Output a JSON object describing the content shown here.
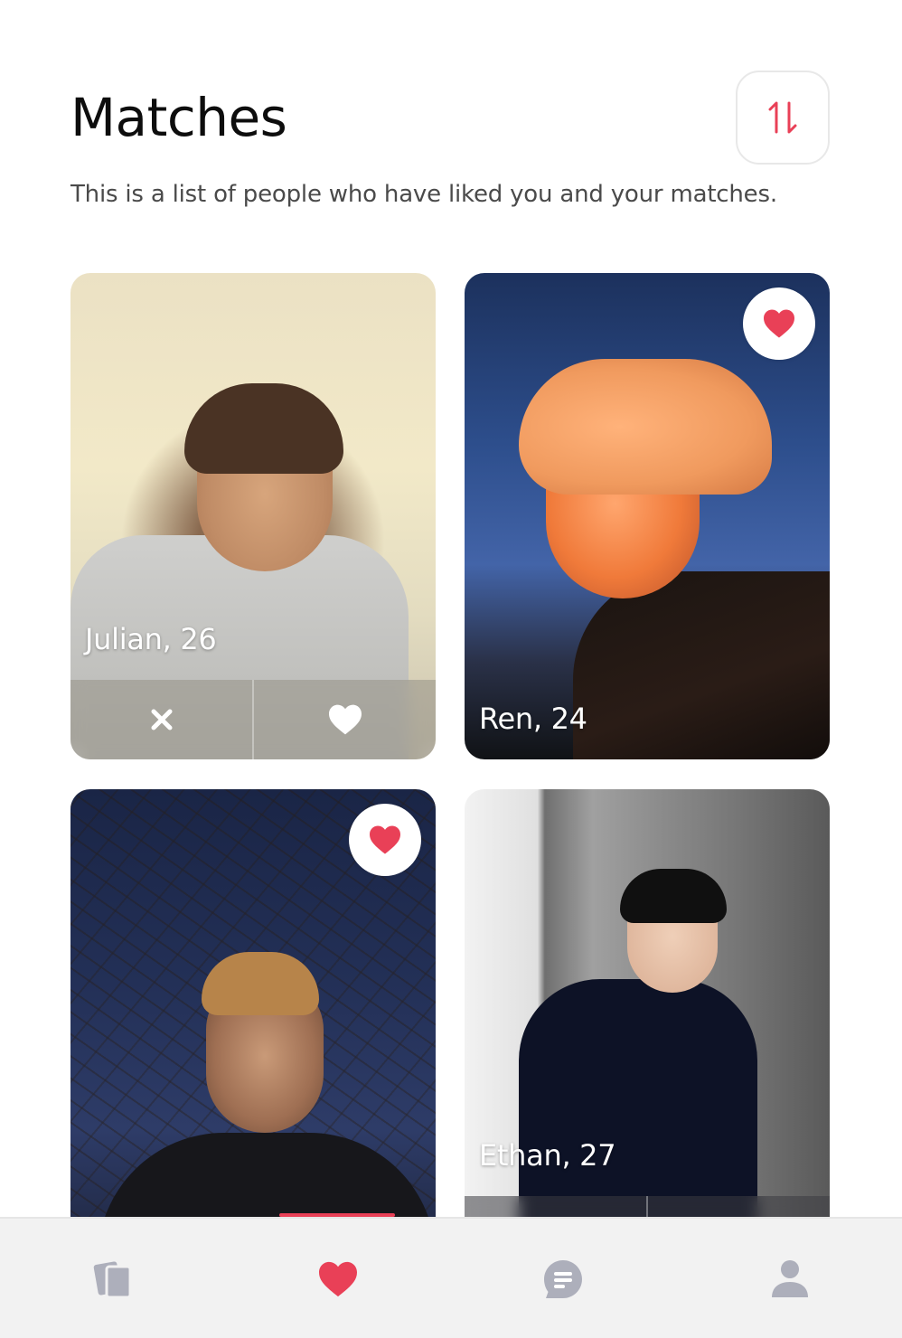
{
  "header": {
    "title": "Matches",
    "subtitle": "This is a list of people who have liked you and your matches."
  },
  "cards": [
    {
      "name_age": "Julian, 26",
      "liked_you": false,
      "has_actions": true
    },
    {
      "name_age": "Ren, 24",
      "liked_you": true,
      "has_actions": false
    },
    {
      "name_age": "",
      "liked_you": true,
      "has_actions": false
    },
    {
      "name_age": "Ethan, 27",
      "liked_you": false,
      "has_actions": true
    }
  ],
  "actions": {
    "dismiss_icon": "close-icon",
    "like_icon": "heart-icon"
  },
  "tabbar": {
    "items": [
      {
        "icon": "cards-icon",
        "active": false
      },
      {
        "icon": "heart-icon",
        "active": true
      },
      {
        "icon": "chat-icon",
        "active": false
      },
      {
        "icon": "profile-icon",
        "active": false
      }
    ]
  },
  "colors": {
    "accent": "#E94057",
    "inactive_icon": "#ADAFBB",
    "tabbar_bg": "#F2F2F2"
  }
}
